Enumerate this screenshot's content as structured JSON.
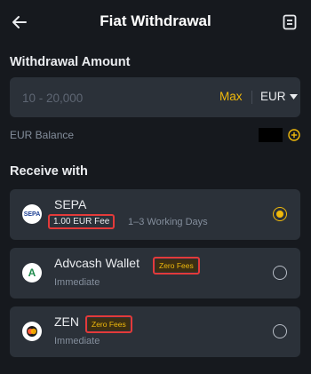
{
  "header": {
    "title": "Fiat Withdrawal"
  },
  "amount": {
    "label": "Withdrawal Amount",
    "placeholder": "10 - 20,000",
    "max_label": "Max",
    "currency": "EUR"
  },
  "balance": {
    "label": "EUR Balance"
  },
  "receive": {
    "label": "Receive with",
    "methods": [
      {
        "name": "SEPA",
        "badge": "1.00 EUR Fee",
        "subtitle": "1–3 Working Days",
        "logo_text": "SEPA",
        "selected": true
      },
      {
        "name": "Advcash Wallet",
        "badge": "Zero Fees",
        "subtitle": "Immediate",
        "logo_text": "A",
        "selected": false
      },
      {
        "name": "ZEN",
        "badge": "Zero Fees",
        "subtitle": "Immediate",
        "logo_text": "",
        "selected": false
      }
    ]
  },
  "colors": {
    "background": "#16191e",
    "card": "#2b3139",
    "accent": "#f0b90b",
    "highlight_border": "#e33a3a"
  }
}
